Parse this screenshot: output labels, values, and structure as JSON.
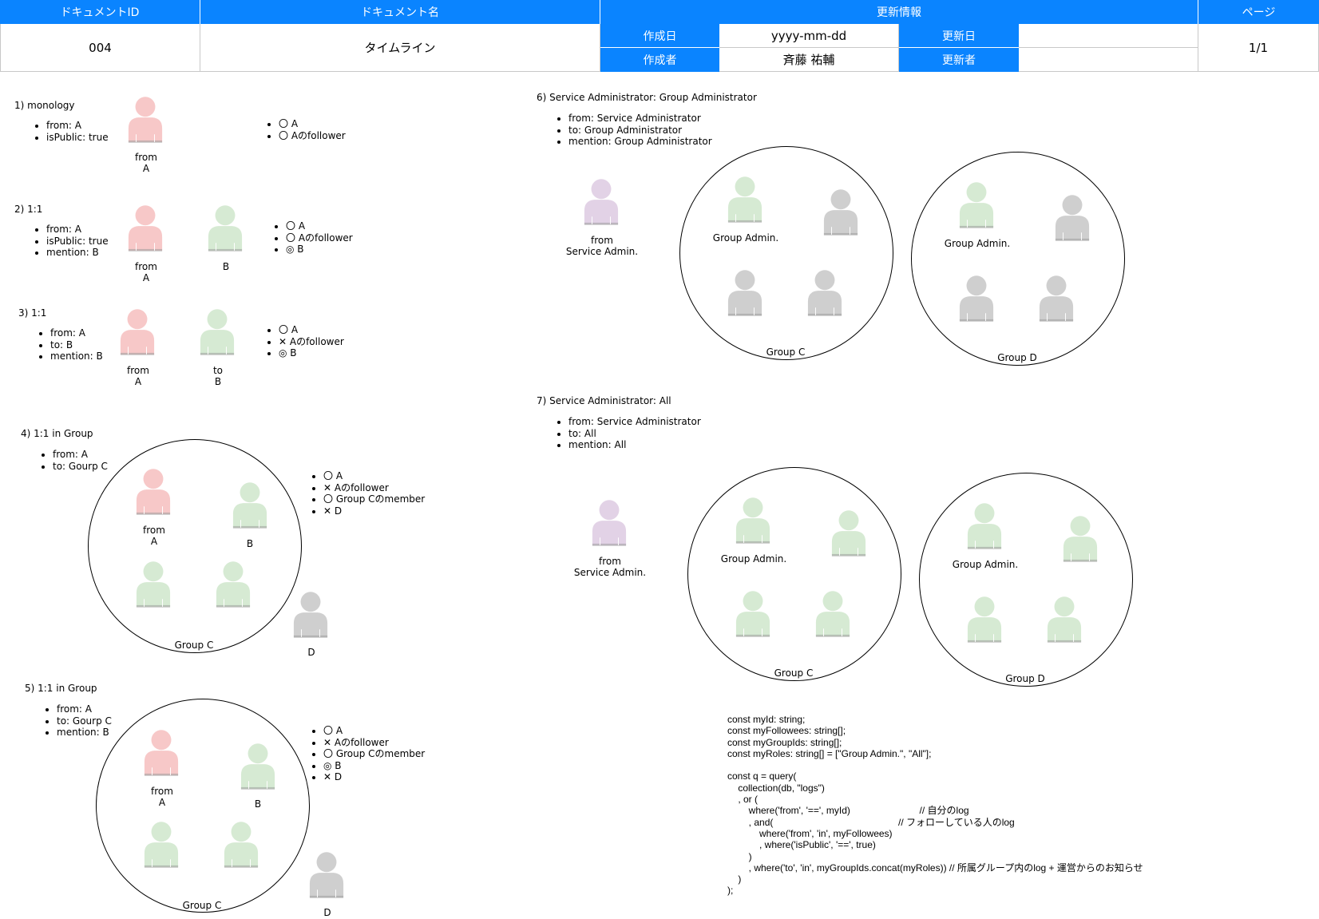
{
  "header": {
    "doc_id_label": "ドキュメントID",
    "doc_name_label": "ドキュメント名",
    "update_info_label": "更新情報",
    "page_label": "ページ",
    "doc_id": "004",
    "doc_name": "タイムライン",
    "created_date_label": "作成日",
    "created_date": "yyyy-mm-dd",
    "updated_date_label": "更新日",
    "updated_date": "",
    "author_label": "作成者",
    "author": "斉藤 祐輔",
    "updater_label": "更新者",
    "updater": "",
    "page": "1/1"
  },
  "colors": {
    "header_blue": "#0a84ff",
    "from_person": "#f7c8c8",
    "member_person": "#d6ead3",
    "other_person": "#cfcfcf",
    "admin_person": "#e2d2e6"
  },
  "sections": {
    "s1": {
      "title": "1) monology",
      "props": [
        "from: A",
        "isPublic: true"
      ],
      "from_caption": [
        "from",
        "A"
      ],
      "visibility": [
        "〇 A",
        "〇 Aのfollower"
      ]
    },
    "s2": {
      "title": "2) 1:1",
      "props": [
        "from: A",
        "isPublic: true",
        "mention: B"
      ],
      "from_caption": [
        "from",
        "A"
      ],
      "b_caption": "B",
      "visibility": [
        "〇 A",
        "〇 Aのfollower",
        "◎ B"
      ]
    },
    "s3": {
      "title": "3) 1:1",
      "props": [
        "from: A",
        "to: B",
        "mention: B"
      ],
      "from_caption": [
        "from",
        "A"
      ],
      "to_caption": [
        "to",
        "B"
      ],
      "visibility": [
        "〇 A",
        "✕ Aのfollower",
        "◎ B"
      ]
    },
    "s4": {
      "title": "4) 1:1 in Group",
      "props": [
        "from: A",
        "to: Gourp C"
      ],
      "from_caption": [
        "from",
        "A"
      ],
      "b_caption": "B",
      "group_caption": "Group C",
      "d_caption": "D",
      "visibility": [
        "〇 A",
        "✕ Aのfollower",
        "〇 Group Cのmember",
        "✕ D"
      ]
    },
    "s5": {
      "title": "5) 1:1 in Group",
      "props": [
        "from: A",
        "to: Gourp C",
        "mention: B"
      ],
      "from_caption": [
        "from",
        "A"
      ],
      "b_caption": "B",
      "group_caption": "Group C",
      "d_caption": "D",
      "visibility": [
        "〇 A",
        "✕ Aのfollower",
        "〇 Group Cのmember",
        "◎ B",
        "✕ D"
      ]
    },
    "s6": {
      "title": "6) Service Administrator: Group Administrator",
      "props": [
        "from: Service Administrator",
        "to: Group Administrator",
        "mention: Group Administrator"
      ],
      "from_caption": [
        "from",
        "Service Admin."
      ],
      "group_admin_caption": "Group Admin.",
      "group_c_caption": "Group C",
      "group_d_caption": "Group D"
    },
    "s7": {
      "title": "7) Service Administrator: All",
      "props": [
        "from: Service Administrator",
        "to: All",
        "mention: All"
      ],
      "from_caption": [
        "from",
        "Service Admin."
      ],
      "group_admin_caption": "Group Admin.",
      "group_c_caption": "Group C",
      "group_d_caption": "Group D"
    }
  },
  "code": "const myId: string;\nconst myFollowees: string[];\nconst myGroupIds: string[];\nconst myRoles: string[] = [\"Group Admin.\", \"All\"];\n\nconst q = query(\n    collection(db, \"logs\")\n    , or (\n        where('from', '==', myId)                          // 自分のlog\n        , and(                                               // フォローしている人のlog\n            where('from', 'in', myFollowees)\n            , where('isPublic', '==', true)\n        )\n        , where('to', 'in', myGroupIds.concat(myRoles)) // 所属グループ内のlog + 運営からのお知らせ\n    )\n);"
}
